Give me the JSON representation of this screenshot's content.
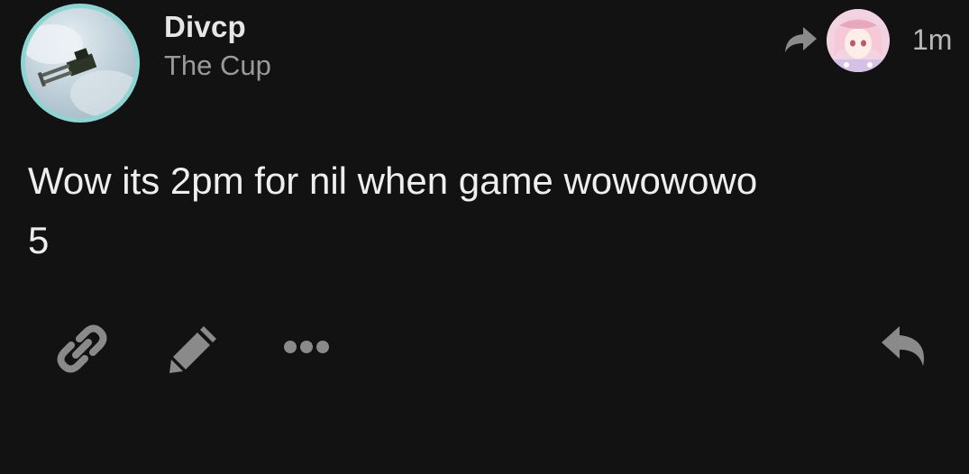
{
  "post": {
    "author": "Divcp",
    "community": "The Cup",
    "time": "1m",
    "body": "Wow its 2pm for nil when game wowowowo\n5"
  },
  "actions": [
    {
      "icon": "link-icon",
      "label": "Copy link"
    },
    {
      "icon": "pencil-icon",
      "label": "Edit"
    },
    {
      "icon": "more-icon",
      "label": "More"
    },
    {
      "icon": "reply-icon",
      "label": "Reply"
    }
  ],
  "colors": {
    "background": "#121212",
    "avatar_ring": "#8fd3d3",
    "icon_gray": "#8a8a8a",
    "text_primary": "#eeeeee",
    "text_secondary": "#9a9a9a"
  }
}
